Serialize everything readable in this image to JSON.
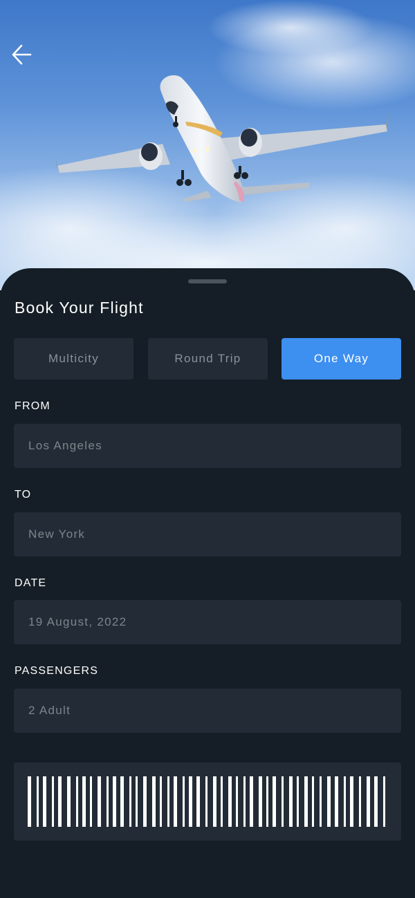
{
  "header": {
    "back_icon": "arrow-left-icon"
  },
  "hero": {
    "image": "airplane-taking-off-photo"
  },
  "booking": {
    "title": "Book Your Flight",
    "trip_types": [
      {
        "label": "Multicity",
        "active": false
      },
      {
        "label": "Round Trip",
        "active": false
      },
      {
        "label": "One Way",
        "active": true
      }
    ],
    "fields": {
      "from": {
        "label": "FROM",
        "value": "Los Angeles"
      },
      "to": {
        "label": "TO",
        "value": "New York"
      },
      "date": {
        "label": "DATE",
        "value": "19 August, 2022"
      },
      "passengers": {
        "label": "PASSENGERS",
        "value": "2 Adult"
      }
    },
    "barcode": "barcode-icon"
  },
  "colors": {
    "background": "#151e26",
    "field_background": "#232c36",
    "accent": "#3d8ff0",
    "text_primary": "#ffffff",
    "text_muted": "#7d848b"
  }
}
